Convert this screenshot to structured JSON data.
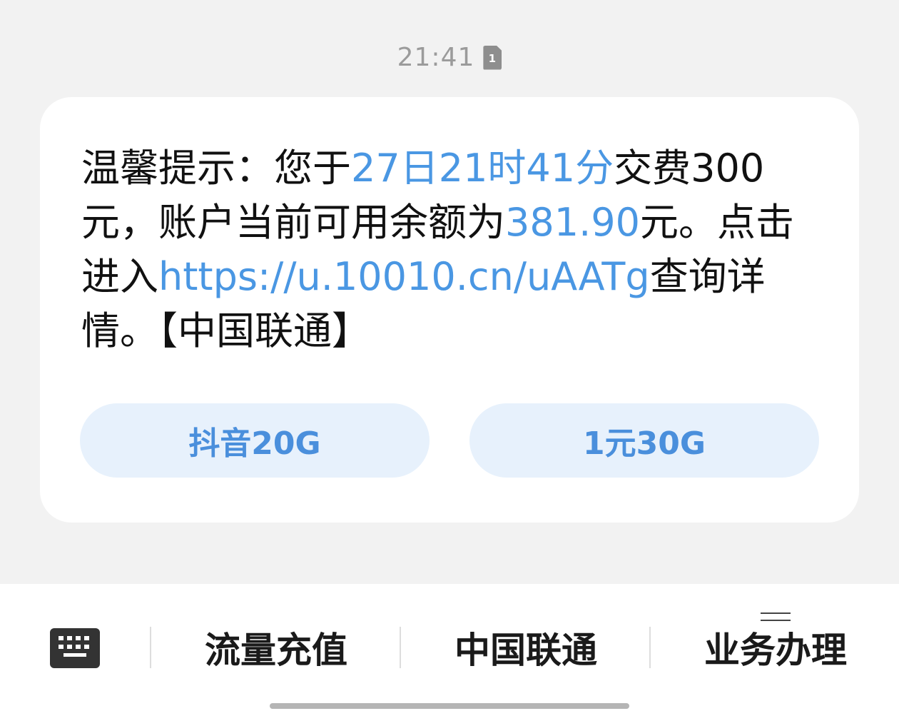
{
  "header": {
    "time": "21:41",
    "sim_slot": "1"
  },
  "message": {
    "p1": "温馨提示：您于",
    "time_link": "27日21时41分",
    "p2": "交费300元，账户当前可用余额为",
    "balance": "381.90",
    "p3": "元。点击进入",
    "url": "https://u.10010.cn/uAATg",
    "p4": "查询详情。【中国联通】"
  },
  "quick_replies": [
    {
      "label": "抖音20G"
    },
    {
      "label": "1元30G"
    }
  ],
  "menu": {
    "items": [
      {
        "label": "流量充值"
      },
      {
        "label": "中国联通"
      },
      {
        "label": "业务办理"
      }
    ]
  },
  "colors": {
    "link": "#4a97e3",
    "button_bg": "#e7f1fc",
    "button_text": "#4a8fdc"
  },
  "icons": {
    "sim": "sim-card-icon",
    "keyboard": "keyboard-icon",
    "submenu": "menu-lines-icon"
  }
}
